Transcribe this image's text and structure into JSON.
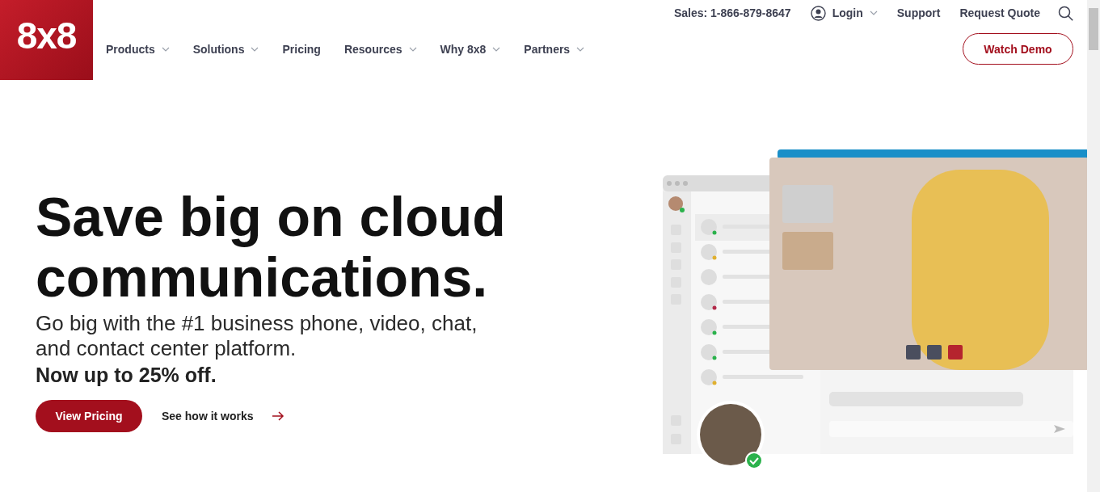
{
  "logo": {
    "text": "8x8"
  },
  "utility_nav": {
    "sales": "Sales: 1-866-879-8647",
    "login": "Login",
    "links": [
      "Support",
      "Request Quote"
    ]
  },
  "nav": [
    {
      "label": "Products",
      "has_menu": true
    },
    {
      "label": "Solutions",
      "has_menu": true
    },
    {
      "label": "Pricing",
      "has_menu": false
    },
    {
      "label": "Resources",
      "has_menu": true
    },
    {
      "label": "Why 8x8",
      "has_menu": true
    },
    {
      "label": "Partners",
      "has_menu": true
    }
  ],
  "watch_demo": "Watch Demo",
  "hero": {
    "headline": "Save big on cloud communications.",
    "subtitle": "Go big with the #1 business phone, video, chat, and contact center platform.",
    "offer": "Now up to 25% off.",
    "primary_button": "View Pricing",
    "secondary_link": "See how it works"
  }
}
